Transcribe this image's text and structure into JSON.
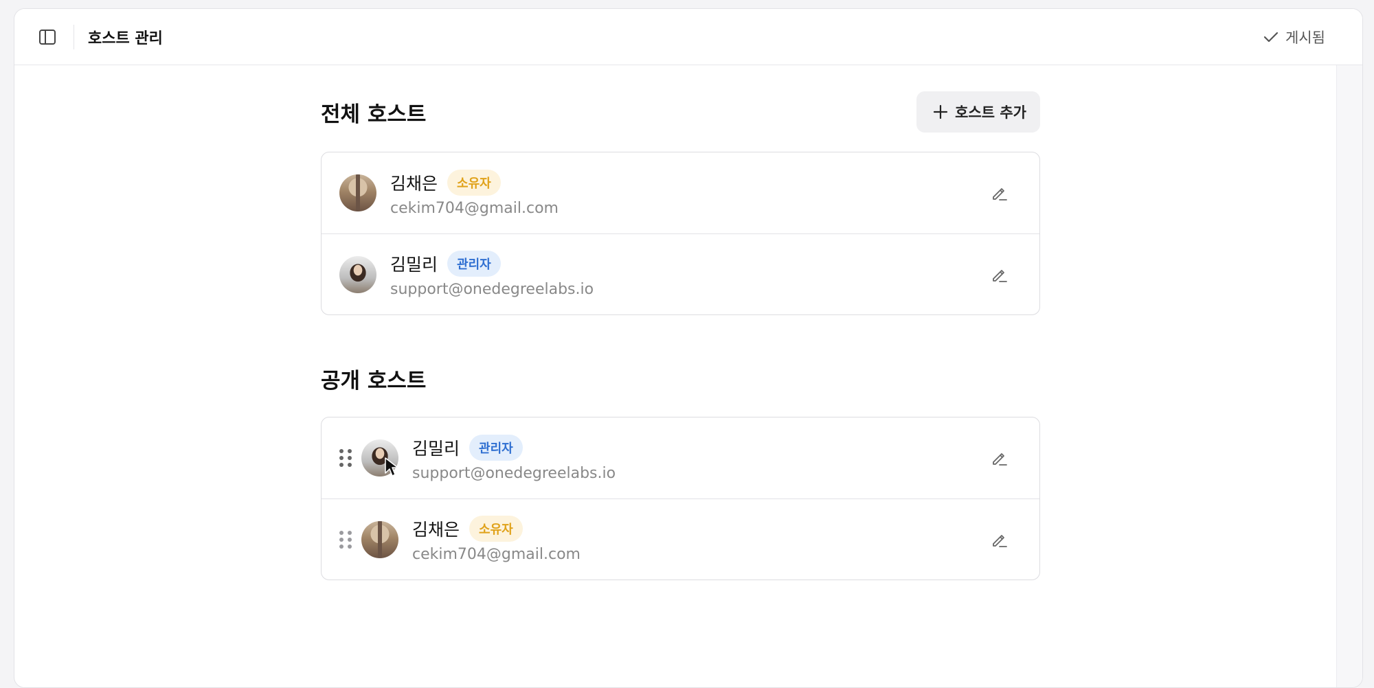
{
  "header": {
    "title": "호스트 관리",
    "status_label": "게시됨"
  },
  "all_hosts": {
    "title": "전체 호스트",
    "add_button_label": "호스트 추가",
    "items": [
      {
        "name": "김채은",
        "role": "소유자",
        "email": "cekim704@gmail.com"
      },
      {
        "name": "김밀리",
        "role": "관리자",
        "email": "support@onedegreelabs.io"
      }
    ]
  },
  "public_hosts": {
    "title": "공개 호스트",
    "items": [
      {
        "name": "김밀리",
        "role": "관리자",
        "email": "support@onedegreelabs.io"
      },
      {
        "name": "김채은",
        "role": "소유자",
        "email": "cekim704@gmail.com"
      }
    ]
  },
  "colors": {
    "owner_badge_text": "#e0a21a",
    "owner_badge_bg": "#fdf3dd",
    "admin_badge_text": "#2f6fd1",
    "admin_badge_bg": "#e3eefc"
  }
}
